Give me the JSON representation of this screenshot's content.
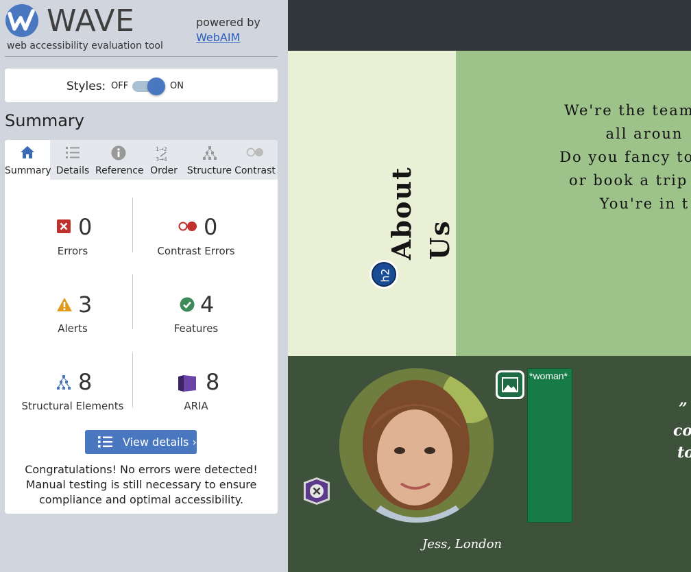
{
  "logo": {
    "wordmark": "WAVE",
    "tagline": "web accessibility evaluation tool"
  },
  "powered": {
    "text": "powered by",
    "link": "WebAIM"
  },
  "styles_toggle": {
    "label": "Styles:",
    "off": "OFF",
    "on": "ON",
    "state": "on"
  },
  "summary": {
    "heading": "Summary"
  },
  "tabs": [
    {
      "label": "Summary",
      "icon": "home-icon",
      "active": true
    },
    {
      "label": "Details",
      "icon": "list-icon"
    },
    {
      "label": "Reference",
      "icon": "info-icon"
    },
    {
      "label": "Order",
      "icon": "order-icon"
    },
    {
      "label": "Structure",
      "icon": "structure-icon"
    },
    {
      "label": "Contrast",
      "icon": "contrast-icon"
    }
  ],
  "metrics": [
    {
      "count": "0",
      "label": "Errors",
      "icon": "error-icon",
      "color": "#c0312e"
    },
    {
      "count": "0",
      "label": "Contrast Errors",
      "icon": "contrast-error-icon",
      "color": "#c0312e"
    },
    {
      "count": "3",
      "label": "Alerts",
      "icon": "alert-icon",
      "color": "#e09a1a"
    },
    {
      "count": "4",
      "label": "Features",
      "icon": "feature-icon",
      "color": "#3e8a5a"
    },
    {
      "count": "8",
      "label": "Structural Elements",
      "icon": "structure-icon",
      "color": "#4a78c0"
    },
    {
      "count": "8",
      "label": "ARIA",
      "icon": "aria-icon",
      "color": "#5b3a8c"
    }
  ],
  "view_details": {
    "label": "View details ›"
  },
  "congrats": "Congratulations! No errors were detected! Manual testing is still necessary to ensure compliance and optimal accessibility.",
  "preview": {
    "about_heading": "About Us",
    "h2_badge": "h2",
    "text_lines": [
      "We're the team wh",
      "all aroun",
      "Do you fancy to sha",
      "or book a trip thr",
      "You're in t"
    ],
    "woman_alt": "*woman*",
    "caption": "Jess, London",
    "quote_lines": [
      "”",
      "co",
      "to"
    ],
    "colors": {
      "top": "#32363d",
      "about_bg": "#eaf0d6",
      "green_bg": "#9dc28a",
      "bottom": "#3e513a"
    }
  }
}
